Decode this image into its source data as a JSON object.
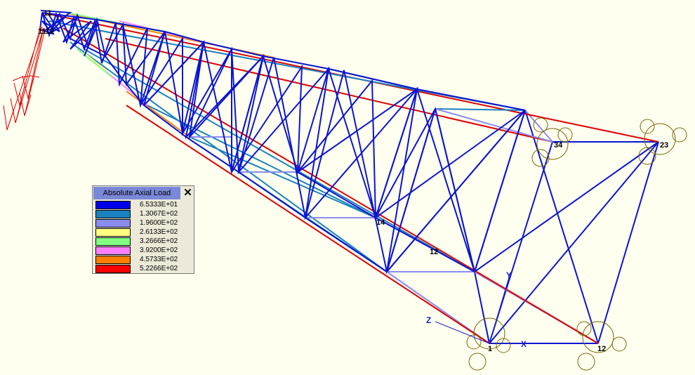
{
  "colors": {
    "background": "#fffff0",
    "member": "#0a14d2",
    "chord": "#e00000",
    "diag_light": "#8a8cf0",
    "diag_teal": "#1a82c0",
    "support": "#7a6a08",
    "load": "#e00000",
    "axis": "#2020c8"
  },
  "legend": {
    "title": "Absolute Axial Load",
    "close_label": "✕",
    "entries": [
      {
        "value": "6.5333E+01",
        "color": "#0000e8"
      },
      {
        "value": "1.3067E+02",
        "color": "#1a82c0"
      },
      {
        "value": "1.9600E+02",
        "color": "#8a8cf0"
      },
      {
        "value": "2.6133E+02",
        "color": "#ffff80"
      },
      {
        "value": "3.2666E+02",
        "color": "#80ff80"
      },
      {
        "value": "3.9200E+02",
        "color": "#ff80ff"
      },
      {
        "value": "4.5733E+02",
        "color": "#ff8000"
      },
      {
        "value": "5.2266E+02",
        "color": "#ff0000"
      }
    ]
  },
  "nodes": {
    "n1": "1",
    "n12": "12",
    "n23": "23",
    "n34": "34",
    "n14": "14",
    "n12b": "12",
    "tip_top": "11",
    "tip_bottom": "1112"
  },
  "axes": {
    "x": "X",
    "y": "Y",
    "z": "Z"
  }
}
